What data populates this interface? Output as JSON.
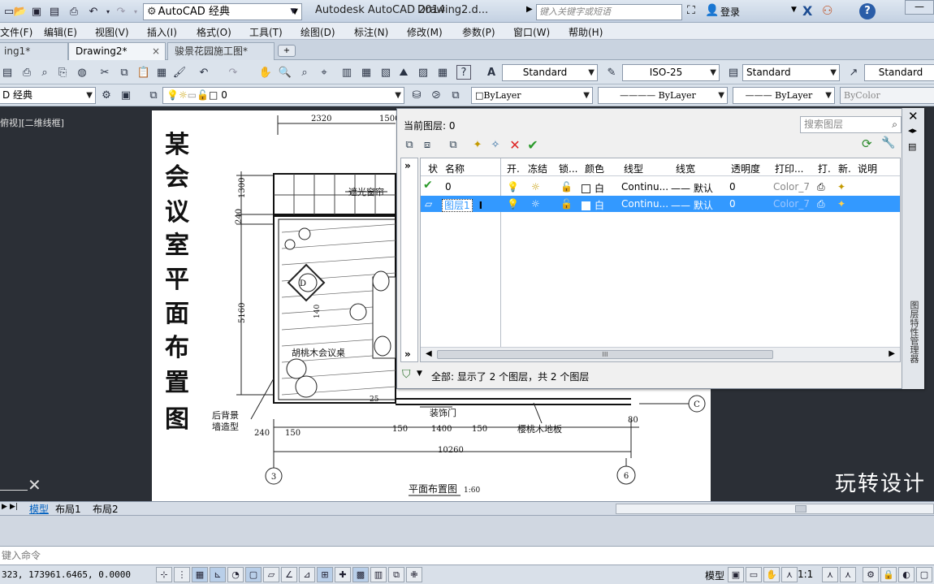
{
  "titlebar": {
    "workspace": "AutoCAD 经典",
    "app_title": "Autodesk AutoCAD 2014",
    "doc_title": "Drawing2.d...",
    "search_placeholder": "键入关键字或短语",
    "login": "登录"
  },
  "menu": [
    "文件(F)",
    "编辑(E)",
    "视图(V)",
    "插入(I)",
    "格式(O)",
    "工具(T)",
    "绘图(D)",
    "标注(N)",
    "修改(M)",
    "参数(P)",
    "窗口(W)",
    "帮助(H)"
  ],
  "tabs": {
    "tab1": "ing1*",
    "tab2": "Drawing2*",
    "tab3": "骏景花园施工图*"
  },
  "toolbar": {
    "text_style": "Standard",
    "dim_style": "ISO-25",
    "table_style": "Standard",
    "multileader_style": "Standard",
    "workspace_left": "D 经典",
    "layer_current": "0",
    "color": "ByLayer",
    "linetype": "———— ByLayer",
    "lineweight": "——— ByLayer",
    "plotstyle": "ByColor"
  },
  "viewport_label": "俯视][二维线框]",
  "watermark": "玩转设计",
  "layer_palette": {
    "current_layer": "当前图层: 0",
    "search_placeholder": "搜索图层",
    "columns": [
      "状",
      "名称",
      "开.",
      "冻结",
      "锁...",
      "颜色",
      "线型",
      "线宽",
      "透明度",
      "打印...",
      "打.",
      "新.",
      "说明"
    ],
    "rows": [
      {
        "name": "0",
        "color": "白",
        "linetype": "Continu...",
        "lineweight": "—— 默认",
        "transparency": "0",
        "plot_style": "Color_7",
        "selected": false
      },
      {
        "name": "图层1",
        "color": "白",
        "linetype": "Continu...",
        "lineweight": "—— 默认",
        "transparency": "0",
        "plot_style": "Color_7",
        "selected": true
      }
    ],
    "status": "全部: 显示了 2 个图层，共 2 个图层",
    "side_label": "图层特性管理器",
    "scroll_thumb": "III"
  },
  "layout_tabs": {
    "model": "模型",
    "layout1": "布局1",
    "layout2": "布局2"
  },
  "command_placeholder": "键入命令",
  "statusbar": {
    "coords": "323, 173961.6465, 0.0000",
    "model_label": "模型",
    "scale": "1:1"
  },
  "drawing_text": {
    "title_chars": [
      "某",
      "会",
      "议",
      "室",
      "平",
      "面",
      "布",
      "置",
      "图"
    ],
    "dims_top": [
      "2320",
      "1500"
    ],
    "dims_left": [
      "1300",
      "240",
      "5160"
    ],
    "dims_bottom": [
      "240",
      "150",
      "150",
      "1400",
      "150",
      "10260"
    ],
    "dim_80": "80",
    "dim_inner": "140",
    "label_blind": "遮光窗帘",
    "label_table": "胡桃木会议桌",
    "label_door": "装饰门",
    "label_floor": "樱桃木地板",
    "label_wall": [
      "后背景",
      "墙造型"
    ],
    "grid_d": "D",
    "grid_c": "C",
    "grid_3": "3",
    "grid_6": "6",
    "label_25": "25",
    "plan_caption": "平面布置图",
    "plan_scale": "1:60"
  }
}
